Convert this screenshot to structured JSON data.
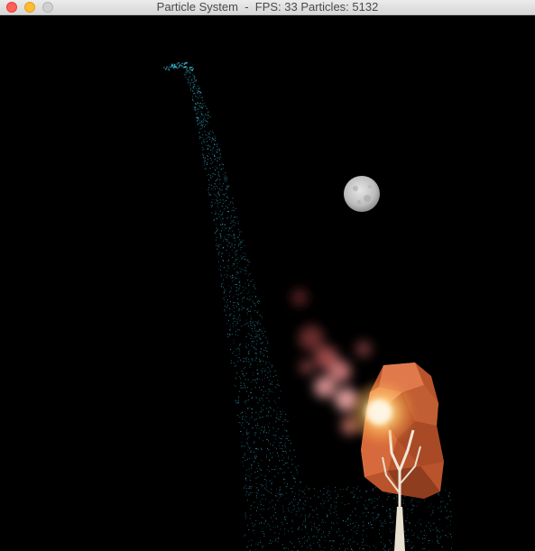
{
  "window": {
    "title": "Particle System  -  FPS: 33 Particles: 5132",
    "buttons": {
      "close": "close-button",
      "minimize": "minimize-button",
      "zoom": "zoom-button"
    }
  },
  "scene": {
    "background_color": "#000000",
    "water_color": "#3cc0e0",
    "moon_color": "#c8c8c8",
    "fire_color": "#ff9a9a",
    "tree_color": "#d8643c",
    "trunk_color": "#e8e0d0"
  }
}
